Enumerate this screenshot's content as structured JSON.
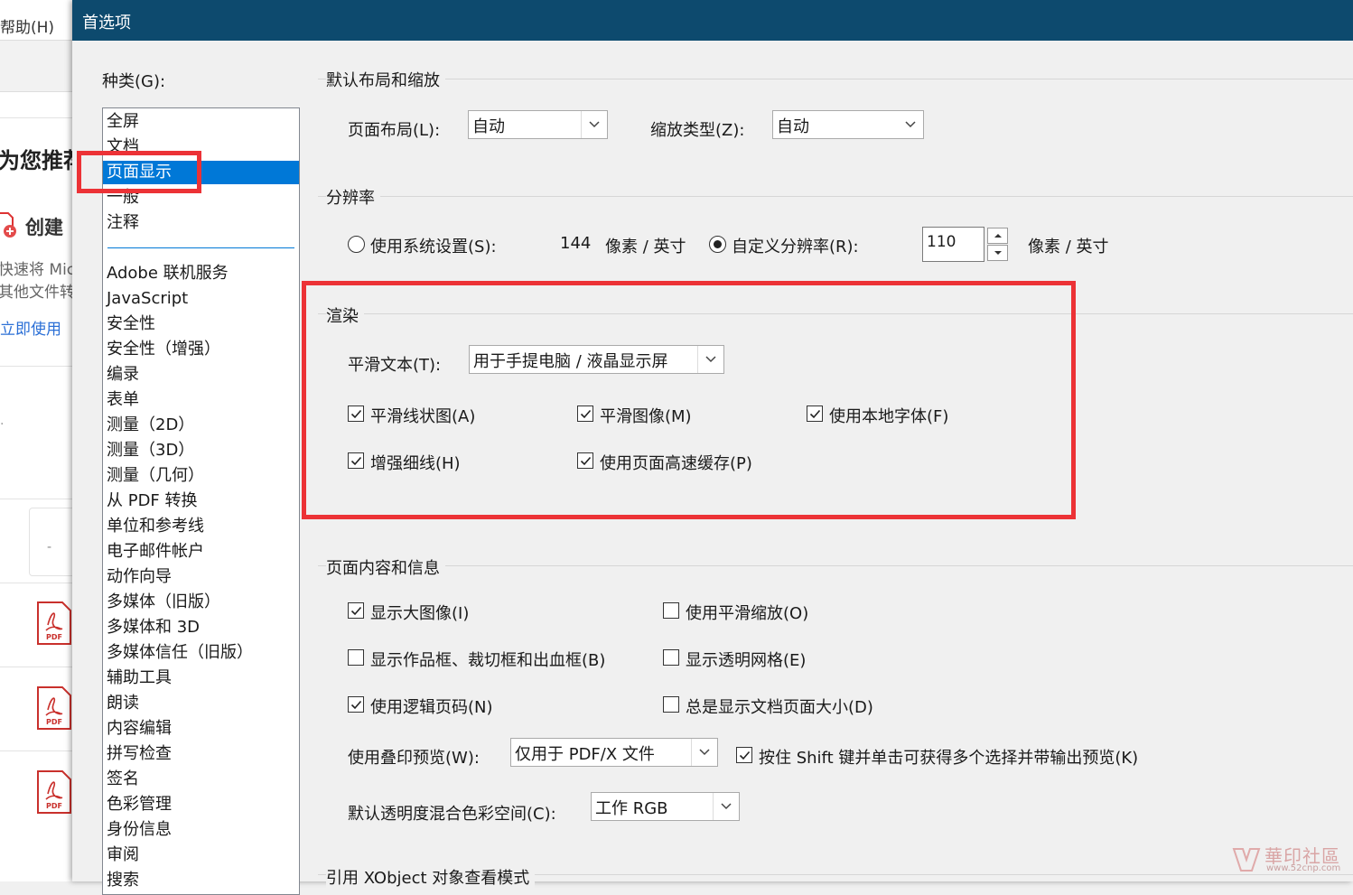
{
  "background_app": {
    "menu_help": "帮助(H)",
    "recommend_heading": "为您推荐",
    "create_label": "创建",
    "line1": "快速将 Mic",
    "line2": "其他文件转",
    "link_use_now": "立即使用",
    "pdf_label": "PDF",
    "dash": "-"
  },
  "dialog": {
    "title": "首选项",
    "category_label": "种类(G):",
    "categories_top": [
      "全屏",
      "文档",
      "页面显示",
      "一般",
      "注释"
    ],
    "selected_category": "页面显示",
    "categories_rest": [
      "Adobe 联机服务",
      "JavaScript",
      "安全性",
      "安全性（增强）",
      "编录",
      "表单",
      "测量（2D）",
      "测量（3D）",
      "测量（几何）",
      "从 PDF 转换",
      "单位和参考线",
      "电子邮件帐户",
      "动作向导",
      "多媒体（旧版）",
      "多媒体和 3D",
      "多媒体信任（旧版）",
      "辅助工具",
      "朗读",
      "内容编辑",
      "拼写检查",
      "签名",
      "色彩管理",
      "身份信息",
      "审阅",
      "搜索"
    ]
  },
  "layout_zoom": {
    "title": "默认布局和缩放",
    "page_layout_label": "页面布局(L):",
    "page_layout_value": "自动",
    "zoom_type_label": "缩放类型(Z):",
    "zoom_type_value": "自动"
  },
  "resolution": {
    "title": "分辨率",
    "use_system_label": "使用系统设置(S):",
    "use_system_checked": false,
    "system_value": "144",
    "system_unit": "像素 / 英寸",
    "custom_label": "自定义分辨率(R):",
    "custom_checked": true,
    "custom_value": "110",
    "custom_unit": "像素 / 英寸"
  },
  "rendering": {
    "title": "渲染",
    "smooth_text_label": "平滑文本(T):",
    "smooth_text_value": "用于手提电脑 / 液晶显示屏",
    "smooth_line_art": {
      "label": "平滑线状图(A)",
      "checked": true
    },
    "smooth_images": {
      "label": "平滑图像(M)",
      "checked": true
    },
    "local_fonts": {
      "label": "使用本地字体(F)",
      "checked": true
    },
    "enhance_thin_lines": {
      "label": "增强细线(H)",
      "checked": true
    },
    "page_cache": {
      "label": "使用页面高速缓存(P)",
      "checked": true
    }
  },
  "page_content": {
    "title": "页面内容和信息",
    "show_large_images": {
      "label": "显示大图像(I)",
      "checked": true
    },
    "smooth_zoom": {
      "label": "使用平滑缩放(O)",
      "checked": false
    },
    "show_boxes": {
      "label": "显示作品框、裁切框和出血框(B)",
      "checked": false
    },
    "transparency_grid": {
      "label": "显示透明网格(E)",
      "checked": false
    },
    "logical_page_numbers": {
      "label": "使用逻辑页码(N)",
      "checked": true
    },
    "always_show_page_size": {
      "label": "总是显示文档页面大小(D)",
      "checked": false
    },
    "overprint_label": "使用叠印预览(W):",
    "overprint_value": "仅用于 PDF/X 文件",
    "shift_click": {
      "label": "按住 Shift 键并单击可获得多个选择并带输出预览(K)",
      "checked": true
    },
    "blend_space_label": "默认透明度混合色彩空间(C):",
    "blend_space_value": "工作 RGB"
  },
  "xobject": {
    "title": "引用 XObject 对象查看模式"
  },
  "watermark": {
    "text": "華印社區",
    "url": "www.52cnp.com"
  },
  "colors": {
    "titlebar": "#0d4a6e",
    "selection": "#0078d7",
    "highlight_box": "#ec3236",
    "link": "#2b6fd6"
  }
}
